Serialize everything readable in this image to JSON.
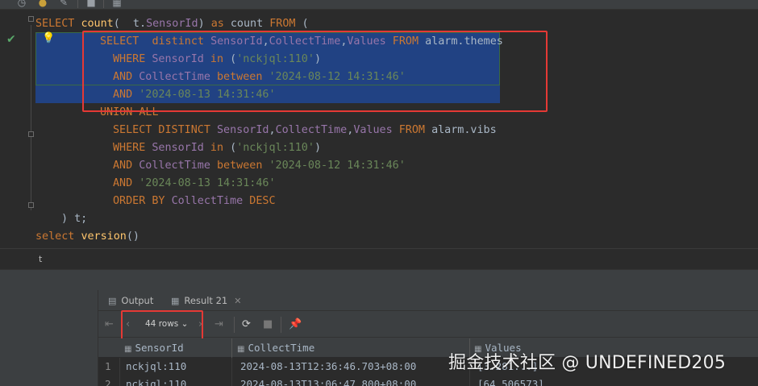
{
  "toolbar": {
    "icons": [
      "history-icon",
      "transaction-icon",
      "wrench-icon",
      "stop-icon",
      "table-icon"
    ]
  },
  "editor": {
    "lines": [
      {
        "tokens": [
          [
            "kw",
            "SELECT "
          ],
          [
            "fn",
            "count"
          ],
          [
            "tx",
            "(  t."
          ],
          [
            "id",
            "SensorId"
          ],
          [
            "tx",
            ") "
          ],
          [
            "kw",
            "as"
          ],
          [
            "tx",
            " count "
          ],
          [
            "kw",
            "FROM"
          ],
          [
            "tx",
            " ("
          ]
        ]
      },
      {
        "tokens": [
          [
            "kw",
            "SELECT  distinct "
          ],
          [
            "id",
            "SensorId"
          ],
          [
            "tx",
            ","
          ],
          [
            "id",
            "CollectTime"
          ],
          [
            "tx",
            ","
          ],
          [
            "id",
            "Values"
          ],
          [
            "kw",
            " FROM "
          ],
          [
            "tx",
            "alarm.themes"
          ]
        ]
      },
      {
        "tokens": [
          [
            "kw",
            "WHERE "
          ],
          [
            "id",
            "SensorId"
          ],
          [
            "kw",
            " in "
          ],
          [
            "tx",
            "("
          ],
          [
            "st",
            "'nckjql:110'"
          ],
          [
            "tx",
            ")"
          ]
        ]
      },
      {
        "tokens": [
          [
            "kw",
            "AND "
          ],
          [
            "id",
            "CollectTime"
          ],
          [
            "kw",
            " between "
          ],
          [
            "st",
            "'2024-08-12 14:31:46'"
          ]
        ]
      },
      {
        "tokens": [
          [
            "kw",
            "AND "
          ],
          [
            "st",
            "'2024-08-13 14:31:46'"
          ]
        ]
      },
      {
        "tokens": [
          [
            "kw",
            "UNION ALL"
          ]
        ]
      },
      {
        "tokens": [
          [
            "kw",
            "SELECT DISTINCT "
          ],
          [
            "id",
            "SensorId"
          ],
          [
            "tx",
            ","
          ],
          [
            "id",
            "CollectTime"
          ],
          [
            "tx",
            ","
          ],
          [
            "id",
            "Values"
          ],
          [
            "kw",
            " FROM "
          ],
          [
            "tx",
            "alarm.vibs"
          ]
        ]
      },
      {
        "tokens": [
          [
            "kw",
            "WHERE "
          ],
          [
            "id",
            "SensorId"
          ],
          [
            "kw",
            " in "
          ],
          [
            "tx",
            "("
          ],
          [
            "st",
            "'nckjql:110'"
          ],
          [
            "tx",
            ")"
          ]
        ]
      },
      {
        "tokens": [
          [
            "kw",
            "AND "
          ],
          [
            "id",
            "CollectTime"
          ],
          [
            "kw",
            " between "
          ],
          [
            "st",
            "'2024-08-12 14:31:46'"
          ]
        ]
      },
      {
        "tokens": [
          [
            "kw",
            "AND "
          ],
          [
            "st",
            "'2024-08-13 14:31:46'"
          ]
        ]
      },
      {
        "tokens": [
          [
            "kw",
            "ORDER BY "
          ],
          [
            "id",
            "CollectTime"
          ],
          [
            "kw",
            " DESC"
          ]
        ]
      },
      {
        "tokens": [
          [
            "tx",
            ") t;"
          ]
        ]
      },
      {
        "tokens": [
          [
            "kw",
            "select "
          ],
          [
            "fn",
            "version"
          ],
          [
            "tx",
            "()"
          ]
        ]
      }
    ]
  },
  "status": {
    "text": "t"
  },
  "results": {
    "tabs": [
      {
        "label": "Output",
        "icon": "output-icon"
      },
      {
        "label": "Result 21",
        "icon": "grid-icon",
        "close": "✕"
      }
    ],
    "rows_label": "44 rows",
    "columns": [
      "SensorId",
      "CollectTime",
      "Values"
    ],
    "rows": [
      {
        "num": "1",
        "sensor": "nckjql:110",
        "time": "2024-08-13T12:36:46.703+08:00",
        "values": "[3.281...]"
      },
      {
        "num": "2",
        "sensor": "nckjql:110",
        "time": "2024-08-13T13:06:47.800+08:00",
        "values": "[64.506573]"
      }
    ]
  },
  "watermark": "掘金技术社区 @ UNDEFINED205",
  "colors": {
    "selection": "#214283",
    "keyword": "#cc7832",
    "string": "#6a8759",
    "highlight_box": "#e53935"
  }
}
